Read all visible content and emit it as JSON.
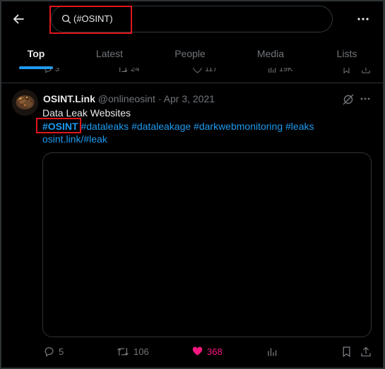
{
  "search": {
    "value": "(#OSINT)",
    "placeholder": "Search"
  },
  "tabs": [
    {
      "label": "Top",
      "active": true
    },
    {
      "label": "Latest"
    },
    {
      "label": "People"
    },
    {
      "label": "Media"
    },
    {
      "label": "Lists"
    }
  ],
  "prev_tweet": {
    "replies": "3",
    "reposts": "24",
    "likes": "117",
    "views": "19K"
  },
  "tweet": {
    "author_name": "OSINT.Link",
    "handle": "@onlineosint",
    "separator": "·",
    "date": "Apr 3, 2021",
    "text_line1": "Data Leak Websites",
    "hashtags": [
      "#OSINT",
      "#dataleaks",
      "#dataleakage",
      "#darkwebmonitoring",
      "#leaks"
    ],
    "link": "osint.link/#leak",
    "stats": {
      "replies": "5",
      "reposts": "106",
      "likes": "368"
    }
  },
  "colors": {
    "accent": "#1d9bf0",
    "like": "#f91880",
    "highlight": "#e0161d",
    "muted": "#71767b"
  }
}
